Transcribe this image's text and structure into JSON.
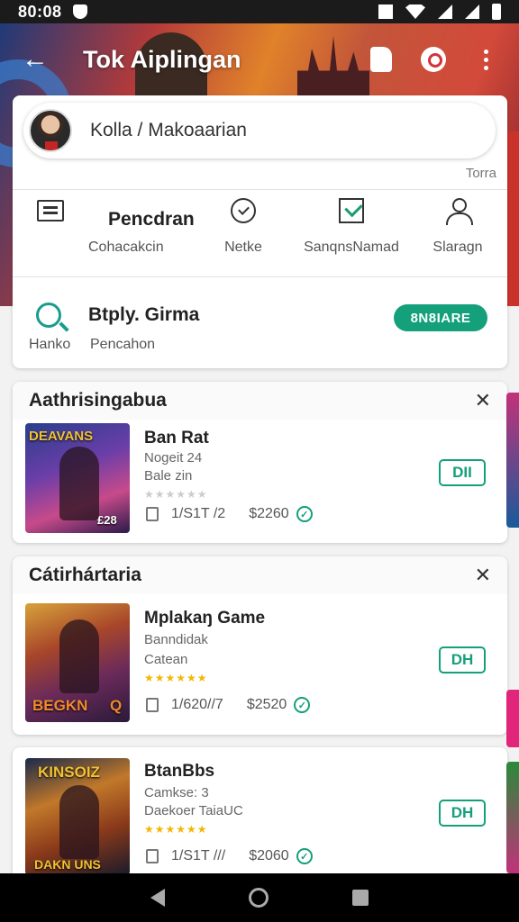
{
  "status_bar": {
    "time": "80:08"
  },
  "header": {
    "title": "Tok Aiplingan"
  },
  "search": {
    "value": "Kolla / Makoaarian",
    "tiny_right": "Torra"
  },
  "actions": [
    {
      "label_main": "Pencdran",
      "label": "Cohacakcin",
      "icon": "chat-icon"
    },
    {
      "label": "Netke",
      "icon": "badge-check-icon"
    },
    {
      "label": "SanqnsNamad",
      "icon": "checkbox-icon"
    },
    {
      "label": "Slaragn",
      "icon": "person-icon"
    }
  ],
  "promo": {
    "title": "Btply. Girma",
    "left_label": "Hanko",
    "sub": "Pencahon",
    "button": "8N8IARE"
  },
  "sections": [
    {
      "title": "Aathrisingabua",
      "items": [
        {
          "name": "Ban Rat",
          "line1": "Nogeit 24",
          "line2": "Bale zin",
          "meta_left": "1/S1T /2",
          "price": "$2260",
          "button": "DII",
          "thumb_text": "DEAVANS",
          "thumb_badge": "£28",
          "stars": "★★★★★★"
        }
      ]
    },
    {
      "title": "Cátirhártaria",
      "items": [
        {
          "name": "Mplakaŋ Game",
          "line1": "Banndidak",
          "line2": "Catean",
          "meta_left": "1/620//7",
          "price": "$2520",
          "button": "DH",
          "thumb_text": "BEGKN",
          "thumb_badge": "Q",
          "stars": "★★★★★★"
        }
      ]
    },
    {
      "title": "",
      "items": [
        {
          "name": "BtanBbs",
          "line1": "Camkse: 3",
          "line2": "Daekoer TaiaUC",
          "meta_left": "1/S1T ///",
          "price": "$2060",
          "button": "DH",
          "thumb_text": "KINSOIZ",
          "thumb_badge": "DAKN UNS",
          "stars": "★★★★★★"
        }
      ]
    }
  ],
  "colors": {
    "accent": "#13a07a",
    "star": "#f2b705"
  }
}
